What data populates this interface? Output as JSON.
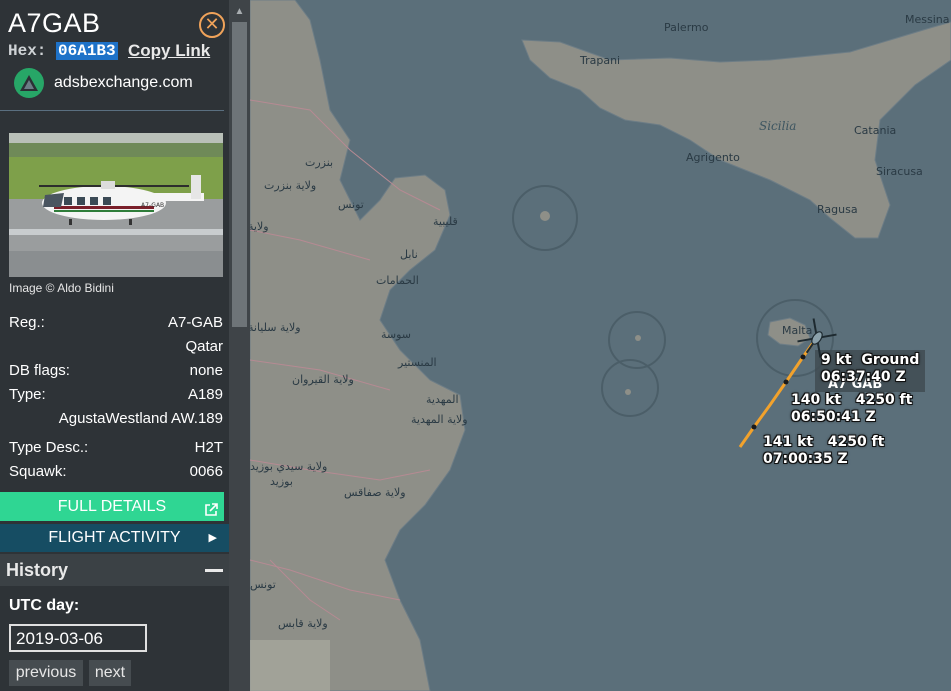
{
  "sidebar": {
    "callsign": "A7GAB",
    "hex_label": "Hex:",
    "hex_value": "06A1B3",
    "copy_link": "Copy Link",
    "source": "adsbexchange.com",
    "image_credit": "Image © Aldo Bidini",
    "photo_registration": "A7-GAB",
    "info": {
      "reg_label": "Reg.:",
      "reg_value": "A7-GAB",
      "country": "Qatar",
      "dbflags_label": "DB flags:",
      "dbflags_value": "none",
      "type_label": "Type:",
      "type_value": "A189",
      "type_full": "AgustaWestland AW.189",
      "typedesc_label": "Type Desc.:",
      "typedesc_value": "H2T",
      "squawk_label": "Squawk:",
      "squawk_value": "0066"
    },
    "full_details": "FULL DETAILS",
    "flight_activity": "FLIGHT ACTIVITY",
    "history_title": "History",
    "utc_label": "UTC day:",
    "date_value": "2019-03-06",
    "previous": "previous",
    "next": "next"
  },
  "map": {
    "places": {
      "palermo": "Palermo",
      "messina": "Messina",
      "trapani": "Trapani",
      "sicilia": "Sicilia",
      "catania": "Catania",
      "agrigento": "Agrigento",
      "siracusa": "Siracusa",
      "ragusa": "Ragusa",
      "malta": "Malta",
      "tunis": "تونس",
      "bizerte": "بنزرت",
      "bizerte_gov": "ولاية بنزرت",
      "kelibia": "قليبية",
      "nabeul": "نابل",
      "hammamet": "الحمامات",
      "sousse": "سوسة",
      "monastir": "المنستير",
      "kairouan": "ولاية القيروان",
      "mahdia": "المهدية",
      "mahdia_gov": "ولاية المهدية",
      "sfax_gov": "ولاية صفاقس",
      "sidi_bouzid": "ولاية سيدي بوزيد",
      "bouzid": "بوزيد",
      "siliana": "ولاية سليانة",
      "tunisia": "تونس",
      "gabes_gov": "ولاية قابس",
      "west_gov": "ولاية"
    },
    "track_labels": {
      "latest": "9 kt  Ground\n06:37:40 Z",
      "ghost_callsign": "A7 GAB",
      "mid": "140 kt   4250 ft\n06:50:41 Z",
      "first": "141 kt   4250 ft\n07:00:35 Z"
    },
    "colors": {
      "sea": "#5b6f7a",
      "land": "#8e8f88",
      "track": "#f2a22c",
      "accent_green": "#2fd693",
      "accent_blue": "#164d63"
    }
  }
}
